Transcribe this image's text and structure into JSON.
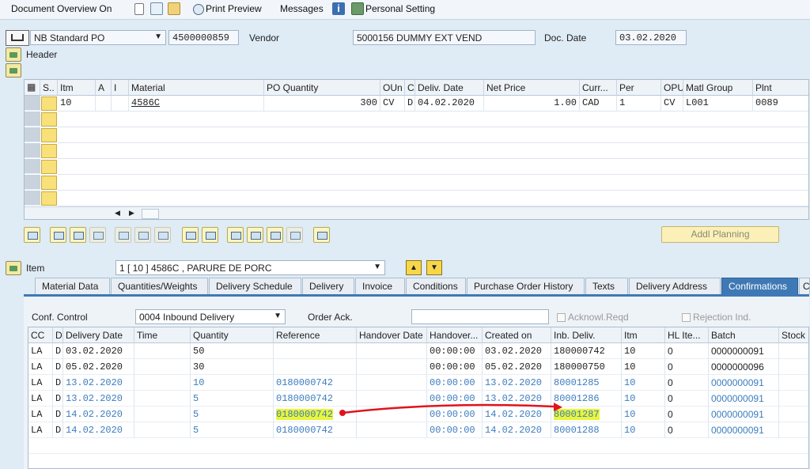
{
  "toolbar": {
    "doc_overview": "Document Overview On",
    "print_preview": "Print Preview",
    "messages": "Messages",
    "personal_setting": "Personal Setting"
  },
  "header_fields": {
    "order_type": "NB Standard PO",
    "po_number": "4500000859",
    "vendor_label": "Vendor",
    "vendor_value": "5000156 DUMMY EXT VEND",
    "doc_date_label": "Doc. Date",
    "doc_date_value": "03.02.2020",
    "header_label": "Header"
  },
  "items_table": {
    "headers": [
      "S..",
      "Itm",
      "A",
      "I",
      "Material",
      "PO Quantity",
      "OUn",
      "C",
      "Deliv. Date",
      "Net Price",
      "Curr...",
      "Per",
      "OPU",
      "Matl Group",
      "Plnt"
    ],
    "row": [
      "10",
      "",
      "",
      "4586C",
      "300",
      "CV",
      "D",
      "04.02.2020",
      "1.00",
      "CAD",
      "1",
      "CV",
      "L001",
      "0089"
    ]
  },
  "buttons": {
    "addl_planning": "Addl Planning"
  },
  "item_section": {
    "label": "Item",
    "selected": "1 [ 10 ] 4586C , PARURE DE PORC"
  },
  "tabs": [
    "Material Data",
    "Quantities/Weights",
    "Delivery Schedule",
    "Delivery",
    "Invoice",
    "Conditions",
    "Purchase Order History",
    "Texts",
    "Delivery Address",
    "Confirmations"
  ],
  "active_tab": "Confirmations",
  "confirmations": {
    "conf_control_label": "Conf. Control",
    "conf_control_value": "0004 Inbound Delivery",
    "order_ack_label": "Order Ack.",
    "acknowl_label": "Acknowl.Reqd",
    "rejection_label": "Rejection Ind.",
    "headers": [
      "CC",
      "D",
      "Delivery Date",
      "Time",
      "Quantity",
      "Reference",
      "Handover Date",
      "Handover...",
      "Created on",
      "Inb. Deliv.",
      "Itm",
      "HL Ite...",
      "Batch",
      "Stock S"
    ],
    "rows": [
      [
        "LA",
        "D",
        "03.02.2020",
        "",
        "50",
        "",
        "",
        "00:00:00",
        "03.02.2020",
        "180000742",
        "10",
        "0",
        "0000000091"
      ],
      [
        "LA",
        "D",
        "05.02.2020",
        "",
        "30",
        "",
        "",
        "00:00:00",
        "05.02.2020",
        "180000750",
        "10",
        "0",
        "0000000096"
      ],
      [
        "LA",
        "D",
        "13.02.2020",
        "",
        "10",
        "0180000742",
        "",
        "00:00:00",
        "13.02.2020",
        "80001285",
        "10",
        "0",
        "0000000091"
      ],
      [
        "LA",
        "D",
        "13.02.2020",
        "",
        "5",
        "0180000742",
        "",
        "00:00:00",
        "13.02.2020",
        "80001286",
        "10",
        "0",
        "0000000091"
      ],
      [
        "LA",
        "D",
        "14.02.2020",
        "",
        "5",
        "0180000742",
        "",
        "00:00:00",
        "14.02.2020",
        "80001287",
        "10",
        "0",
        "0000000091"
      ],
      [
        "LA",
        "D",
        "14.02.2020",
        "",
        "5",
        "0180000742",
        "",
        "00:00:00",
        "14.02.2020",
        "80001288",
        "10",
        "0",
        "0000000091"
      ]
    ]
  },
  "colors": {
    "accent": "#3f79b5",
    "highlight": "#e9f53a",
    "arrow": "#e0141e",
    "link_blue": "#3b7cbf"
  }
}
